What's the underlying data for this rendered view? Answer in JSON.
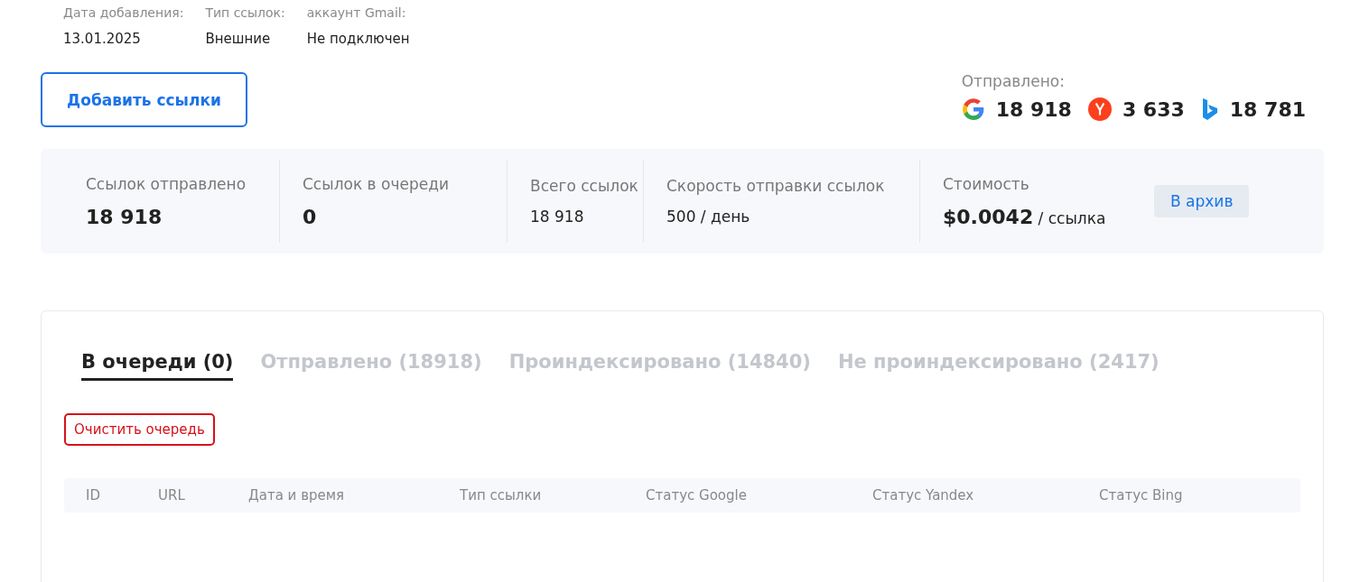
{
  "meta": [
    {
      "label": "Дата добавления:",
      "value": "13.01.2025"
    },
    {
      "label": "Тип ссылок:",
      "value": "Внешние"
    },
    {
      "label": "аккаунт Gmail:",
      "value": "Не подключен"
    }
  ],
  "add_button": "Добавить ссылки",
  "sent": {
    "label": "Отправлено:",
    "engines": [
      {
        "kind": "google",
        "count": "18 918"
      },
      {
        "kind": "yandex",
        "count": "3 633"
      },
      {
        "kind": "bing",
        "count": "18 781"
      }
    ]
  },
  "stats": [
    {
      "label": "Ссылок отправлено",
      "value": "18 918",
      "kind": "bold"
    },
    {
      "label": "Ссылок в очереди",
      "value": "0",
      "kind": "bold"
    },
    {
      "label": "Всего ссылок",
      "value": "18 918",
      "kind": "plain"
    },
    {
      "label": "Скорость отправки ссылок",
      "value": "500 / день",
      "kind": "plain"
    },
    {
      "label": "Стоимость",
      "value": "**$0.0042** / ссылка",
      "kind": "rich"
    }
  ],
  "archive_button": "В архив",
  "tabs": [
    {
      "label": "В очереди (0)",
      "selected": true
    },
    {
      "label": "Отправлено (18918)",
      "selected": false
    },
    {
      "label": "Проиндексировано (14840)",
      "selected": false
    },
    {
      "label": "Не проиндексировано (2417)",
      "selected": false
    }
  ],
  "clear_button": "Очистить очередь",
  "table": {
    "columns": [
      "ID",
      "URL",
      "Дата и время",
      "Тип ссылки",
      "Статус Google",
      "Статус Yandex",
      "Статус Bing"
    ]
  }
}
